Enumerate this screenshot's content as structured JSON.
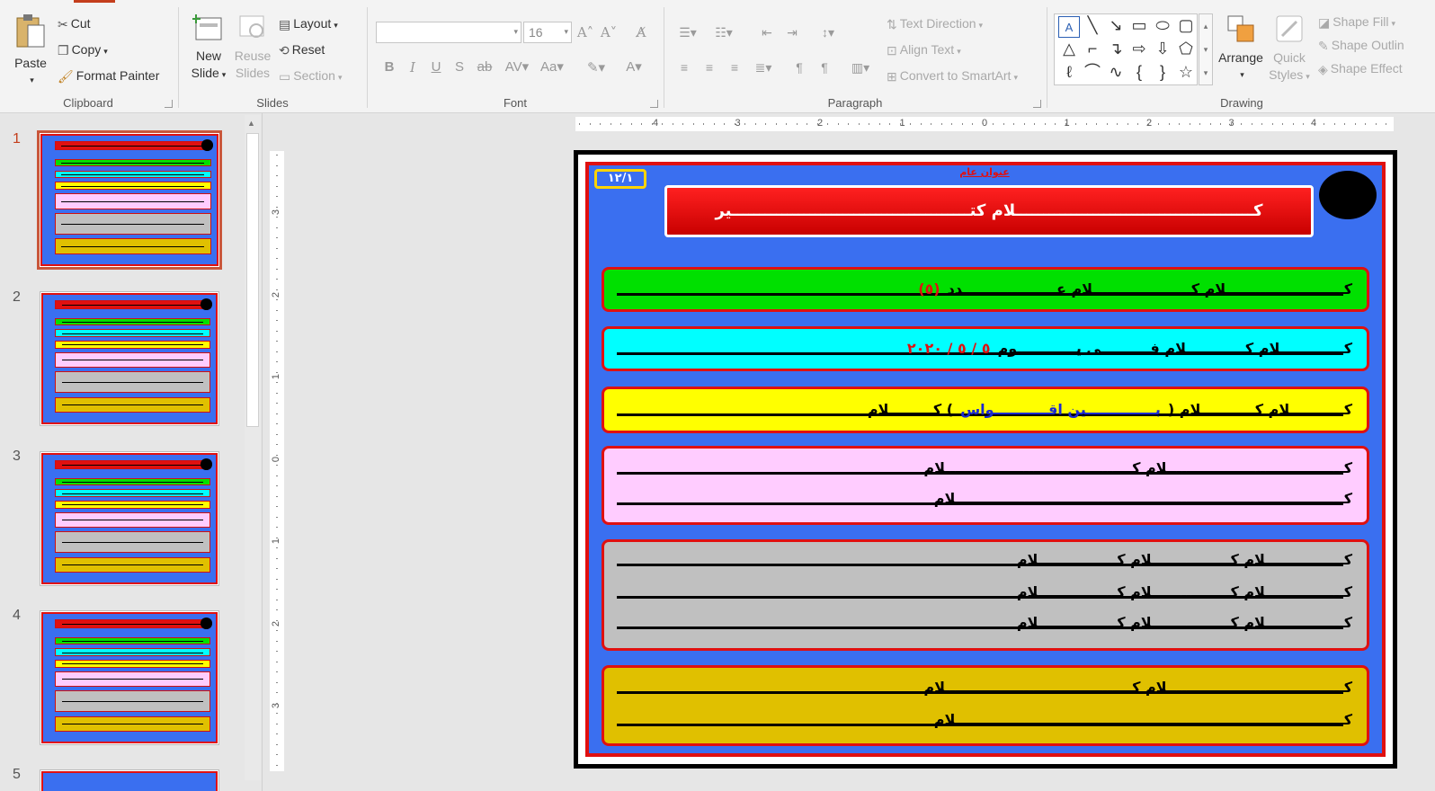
{
  "ribbon": {
    "clipboard": {
      "label": "Clipboard",
      "paste": "Paste",
      "cut": "Cut",
      "copy": "Copy",
      "format_painter": "Format Painter"
    },
    "slides": {
      "label": "Slides",
      "new_slide_1": "New",
      "new_slide_2": "Slide",
      "reuse_1": "Reuse",
      "reuse_2": "Slides",
      "layout": "Layout",
      "reset": "Reset",
      "section": "Section"
    },
    "font": {
      "label": "Font",
      "font_name": "",
      "font_size": "16"
    },
    "paragraph": {
      "label": "Paragraph",
      "text_direction": "Text Direction",
      "align_text": "Align Text",
      "convert_smartart": "Convert to SmartArt"
    },
    "drawing": {
      "label": "Drawing",
      "arrange": "Arrange",
      "quick_1": "Quick",
      "quick_2": "Styles",
      "shape_fill": "Shape Fill",
      "shape_outline": "Shape Outlin",
      "shape_effects": "Shape Effect"
    }
  },
  "thumbnails": {
    "numbers": [
      "1",
      "2",
      "3",
      "4",
      "5"
    ],
    "selected": "1"
  },
  "rulers": {
    "horizontal": [
      "4",
      "3",
      "2",
      "1",
      "0",
      "1",
      "2",
      "3",
      "4"
    ],
    "vertical": [
      "3",
      "2",
      "1",
      "0",
      "1",
      "2",
      "3"
    ]
  },
  "slide": {
    "badge": "١٢/١",
    "top_label": "عنوان عام",
    "title": "كـــــــــــــــــــــــــــــــــــــــــــلام كتـــــــــــــــــــــــــــــــــــــــــــير",
    "rows": {
      "green": {
        "text": "كــــــــــــــــــــــــلام كــــــــــــــــــــلام عـــــــــــــــــــدد",
        "num": "(٥)"
      },
      "cyan": {
        "text": "كـــــــــــــلام كــــــــــــلام فــــــــــى يــــــــــــوم",
        "num": "٥ / ٥ / ٢٠٢٠"
      },
      "yellow": {
        "a": "كـــــــــــلام كـــــــــــلام (",
        "b": "بــــــــــــــين اقـــــــــــواس",
        "c": ") كـــــــــلام"
      },
      "pink": [
        "كــــــــــــــــــــــــــــــــــــلام كــــــــــــــــــــــــــــــــــــــلام",
        "كـــــــــــــــــــــــــــــــــــــــــــــــــــــــــــــــــــــــــــــــلام"
      ],
      "gray": [
        "كــــــــــــــــلام كــــــــــــــــلام كــــــــــــــــلام",
        "كــــــــــــــــلام كــــــــــــــــلام كــــــــــــــــلام",
        "كــــــــــــــــلام كــــــــــــــــلام كــــــــــــــــلام"
      ],
      "gold": [
        "كــــــــــــــــــــــــــــــــــــلام كــــــــــــــــــــــــــــــــــــــلام",
        "كـــــــــــــــــــــــــــــــــــــــــــــــــــــــــــــــــــــــــــــــلام"
      ]
    }
  },
  "colors": {
    "accent": "#c43e1c",
    "slide_bg": "#3a6ff0",
    "border_red": "#e01010",
    "green": "#00e000",
    "cyan": "#00ffff",
    "yellow": "#ffff00",
    "pink": "#ffccff",
    "gray": "#c0c0c0",
    "gold": "#e0c000"
  }
}
